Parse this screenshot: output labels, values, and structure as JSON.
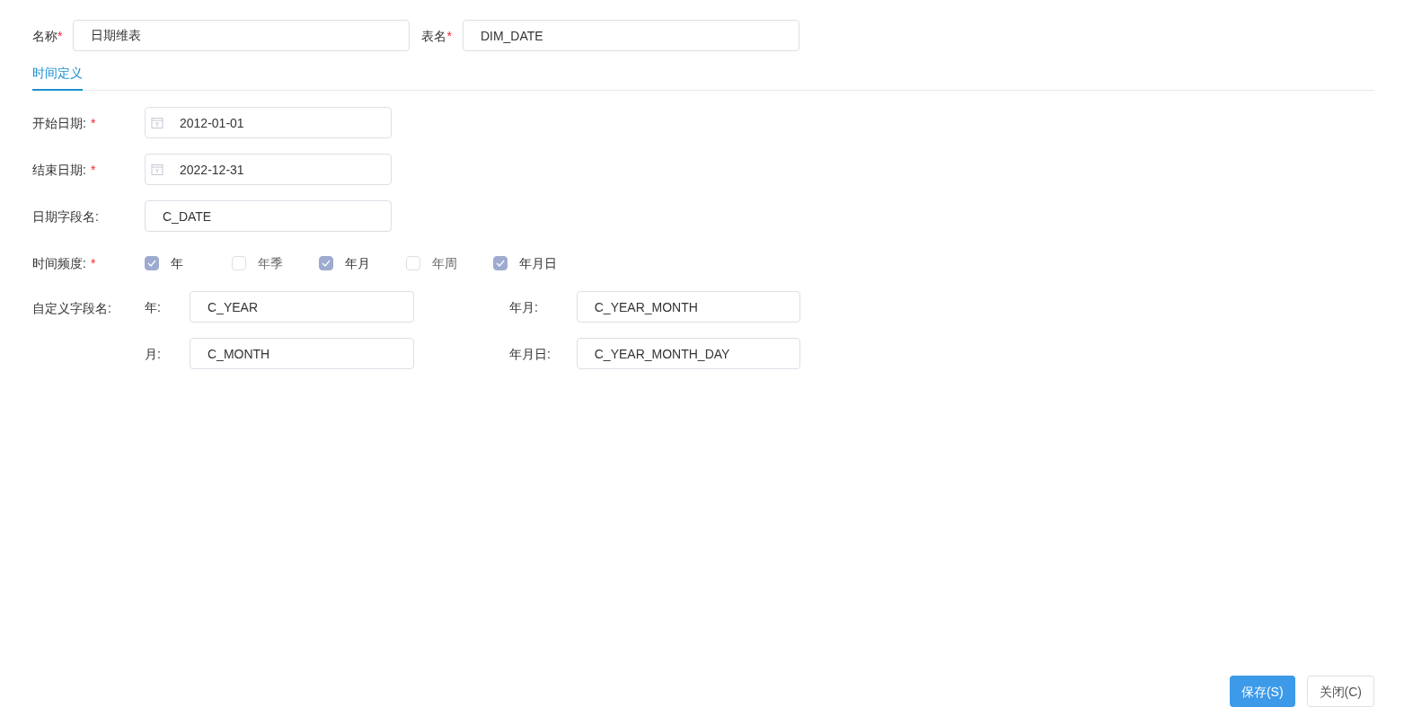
{
  "header_fields": [
    {
      "label": "名称",
      "required_mark": "*",
      "value": "日期维表"
    },
    {
      "label": "表名",
      "required_mark": "*",
      "value": "DIM_DATE"
    }
  ],
  "tabs": [
    {
      "label": "时间定义",
      "selected": true
    }
  ],
  "form_rows": [
    {
      "kind": "date",
      "label": "开始日期:",
      "required_mark": "*",
      "value": "2012-01-01"
    },
    {
      "kind": "date",
      "label": "结束日期:",
      "required_mark": "*",
      "value": "2022-12-31"
    },
    {
      "kind": "text",
      "label": "日期字段名:",
      "value": "C_DATE"
    }
  ],
  "frequency": {
    "label": "时间频度:",
    "required_mark": "*",
    "options": [
      {
        "label": "年",
        "checked": true
      },
      {
        "label": "年季",
        "checked": false
      },
      {
        "label": "年月",
        "checked": true
      },
      {
        "label": "年周",
        "checked": false
      },
      {
        "label": "年月日",
        "checked": true
      }
    ]
  },
  "custom_fields": {
    "label": "自定义字段名:",
    "fields": [
      {
        "label": "年:",
        "value": "C_YEAR"
      },
      {
        "label": "年月:",
        "value": "C_YEAR_MONTH"
      },
      {
        "label": "月:",
        "value": "C_MONTH"
      },
      {
        "label": "年月日:",
        "value": "C_YEAR_MONTH_DAY"
      }
    ]
  },
  "buttons": [
    {
      "label": "保存(S)",
      "kind": "primary"
    },
    {
      "label": "关闭(C)",
      "kind": "secondary"
    }
  ]
}
